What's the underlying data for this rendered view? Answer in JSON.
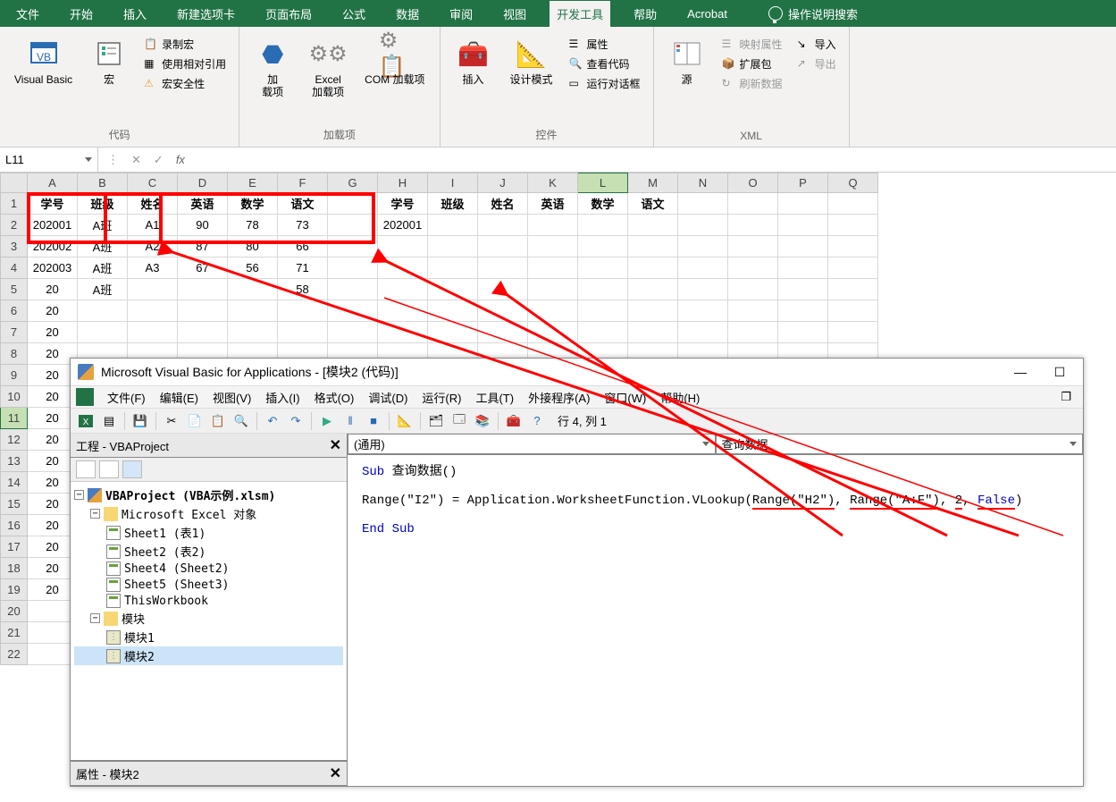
{
  "ribbon": {
    "tabs": [
      "文件",
      "开始",
      "插入",
      "新建选项卡",
      "页面布局",
      "公式",
      "数据",
      "审阅",
      "视图",
      "开发工具",
      "帮助",
      "Acrobat"
    ],
    "active_tab": "开发工具",
    "search_placeholder": "操作说明搜索",
    "groups": {
      "code": {
        "label": "代码",
        "visual_basic": "Visual Basic",
        "macros": "宏",
        "record": "录制宏",
        "relative": "使用相对引用",
        "security": "宏安全性"
      },
      "addins": {
        "label": "加载项",
        "addins": "加\n载项",
        "excel_addins": "Excel\n加载项",
        "com_addins": "COM 加载项"
      },
      "controls": {
        "label": "控件",
        "insert": "插入",
        "design": "设计模式",
        "properties": "属性",
        "view_code": "查看代码",
        "run_dialog": "运行对话框"
      },
      "xml": {
        "label": "XML",
        "source": "源",
        "map_props": "映射属性",
        "expansion": "扩展包",
        "refresh": "刷新数据",
        "import": "导入",
        "export": "导出"
      }
    }
  },
  "name_box": "L11",
  "columns": [
    "A",
    "B",
    "C",
    "D",
    "E",
    "F",
    "G",
    "H",
    "I",
    "J",
    "K",
    "L",
    "M",
    "N",
    "O",
    "P",
    "Q"
  ],
  "row_count": 22,
  "headers_left": [
    "学号",
    "班级",
    "姓名",
    "英语",
    "数学",
    "语文"
  ],
  "headers_right": [
    "学号",
    "班级",
    "姓名",
    "英语",
    "数学",
    "语文"
  ],
  "data_rows": [
    [
      "202001",
      "A班",
      "A1",
      "90",
      "78",
      "73"
    ],
    [
      "202002",
      "A班",
      "A2",
      "87",
      "80",
      "66"
    ],
    [
      "202003",
      "A班",
      "A3",
      "67",
      "56",
      "71"
    ],
    [
      "20",
      "A班",
      "",
      "",
      "",
      "58"
    ],
    [
      "20",
      "",
      "",
      "",
      "",
      ""
    ],
    [
      "20",
      "",
      "",
      "",
      "",
      ""
    ],
    [
      "20",
      "",
      "",
      "",
      "",
      ""
    ],
    [
      "20",
      "",
      "",
      "",
      "",
      ""
    ],
    [
      "20",
      "",
      "",
      "",
      "",
      ""
    ],
    [
      "20",
      "",
      "",
      "",
      "",
      ""
    ],
    [
      "20",
      "",
      "",
      "",
      "",
      ""
    ],
    [
      "20",
      "",
      "",
      "",
      "",
      ""
    ],
    [
      "20",
      "",
      "",
      "",
      "",
      ""
    ],
    [
      "20",
      "",
      "",
      "",
      "",
      ""
    ],
    [
      "20",
      "",
      "",
      "",
      "",
      ""
    ],
    [
      "20",
      "",
      "",
      "",
      "",
      ""
    ],
    [
      "20",
      "",
      "",
      "",
      "",
      ""
    ],
    [
      "20",
      "",
      "",
      "",
      "",
      ""
    ],
    [
      "",
      "",
      "",
      "",
      "",
      ""
    ],
    [
      "",
      "",
      "",
      "",
      "",
      ""
    ],
    [
      "",
      "",
      "",
      "",
      "",
      ""
    ]
  ],
  "lookup_value": "202001",
  "vbe": {
    "title": "Microsoft Visual Basic for Applications - [模块2 (代码)]",
    "menus": [
      "文件(F)",
      "编辑(E)",
      "视图(V)",
      "插入(I)",
      "格式(O)",
      "调试(D)",
      "运行(R)",
      "工具(T)",
      "外接程序(A)",
      "窗口(W)",
      "帮助(H)"
    ],
    "status": "行 4, 列 1",
    "project_title": "工程 - VBAProject",
    "project_root": "VBAProject (VBA示例.xlsm)",
    "excel_objects": "Microsoft Excel 对象",
    "sheets": [
      "Sheet1 (表1)",
      "Sheet2 (表2)",
      "Sheet4 (Sheet2)",
      "Sheet5 (Sheet3)"
    ],
    "workbook": "ThisWorkbook",
    "modules_folder": "模块",
    "modules": [
      "模块1",
      "模块2"
    ],
    "props_title": "属性 - 模块2",
    "code_dd_left": "(通用)",
    "code_dd_right": "查询数据",
    "code": {
      "line1_kw": "Sub",
      "line1_rest": " 查询数据()",
      "line2_a": "Range(\"I2\") = Application.WorksheetFunction.VLookup(",
      "line2_b": "Range(\"H2\")",
      "line2_c": ", ",
      "line2_d": "Range(\"A:F\")",
      "line2_e": ", ",
      "line2_f": "2",
      "line2_g": ", ",
      "line2_h": "False",
      "line2_i": ")",
      "line3": "End Sub"
    }
  }
}
